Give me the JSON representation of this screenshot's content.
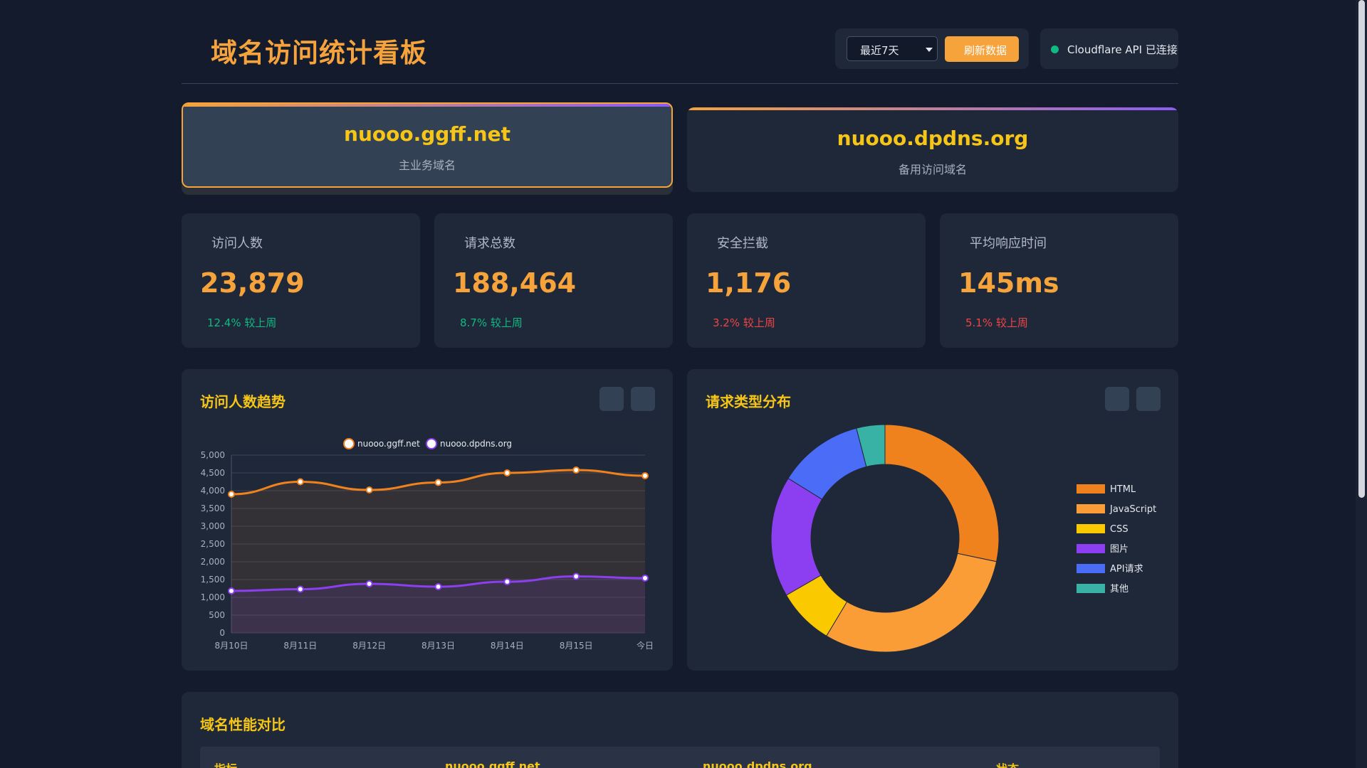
{
  "header": {
    "title": "域名访问统计看板",
    "range_selected": "最近7天",
    "refresh_label": "刷新数据",
    "api_status": "Cloudflare API 已连接"
  },
  "domains": [
    {
      "name": "nuooo.ggff.net",
      "desc": "主业务域名",
      "active": true
    },
    {
      "name": "nuooo.dpdns.org",
      "desc": "备用访问域名",
      "active": false
    }
  ],
  "stats": [
    {
      "label": "访问人数",
      "value": "23,879",
      "change": "12.4% 较上周",
      "trend": "up"
    },
    {
      "label": "请求总数",
      "value": "188,464",
      "change": "8.7% 较上周",
      "trend": "up"
    },
    {
      "label": "安全拦截",
      "value": "1,176",
      "change": "3.2% 较上周",
      "trend": "down"
    },
    {
      "label": "平均响应时间",
      "value": "145ms",
      "change": "5.1% 较上周",
      "trend": "down"
    }
  ],
  "visitors_panel": {
    "title": "访问人数趋势"
  },
  "requests_panel": {
    "title": "请求类型分布"
  },
  "table_panel": {
    "title": "域名性能对比",
    "headers": [
      "指标",
      "nuooo.ggff.net",
      "nuooo.dpdns.org",
      "状态"
    ]
  },
  "chart_data": [
    {
      "type": "line",
      "x": [
        "8月10日",
        "8月11日",
        "8月12日",
        "8月13日",
        "8月14日",
        "8月15日",
        "今日"
      ],
      "series": [
        {
          "name": "nuooo.ggff.net",
          "color": "#f0821e",
          "values": [
            3900,
            4250,
            4020,
            4230,
            4500,
            4580,
            4420
          ]
        },
        {
          "name": "nuooo.dpdns.org",
          "color": "#8b3ff0",
          "values": [
            1180,
            1230,
            1380,
            1300,
            1440,
            1590,
            1540
          ]
        }
      ],
      "ylim": [
        0,
        5000
      ],
      "yticks": [
        "0",
        "500",
        "1,000",
        "1,500",
        "2,000",
        "2,500",
        "3,000",
        "3,500",
        "4,000",
        "4,500",
        "5,000"
      ],
      "legend": "top",
      "grid": true
    },
    {
      "type": "pie",
      "donut": true,
      "categories": [
        "HTML",
        "JavaScript",
        "CSS",
        "图片",
        "API请求",
        "其他"
      ],
      "values": [
        28,
        30,
        8,
        17,
        12,
        4
      ],
      "colors": [
        "#f0821e",
        "#fb9d37",
        "#fbc900",
        "#8b3ff0",
        "#4a6cf7",
        "#38b2a5"
      ],
      "legend": "right"
    }
  ]
}
